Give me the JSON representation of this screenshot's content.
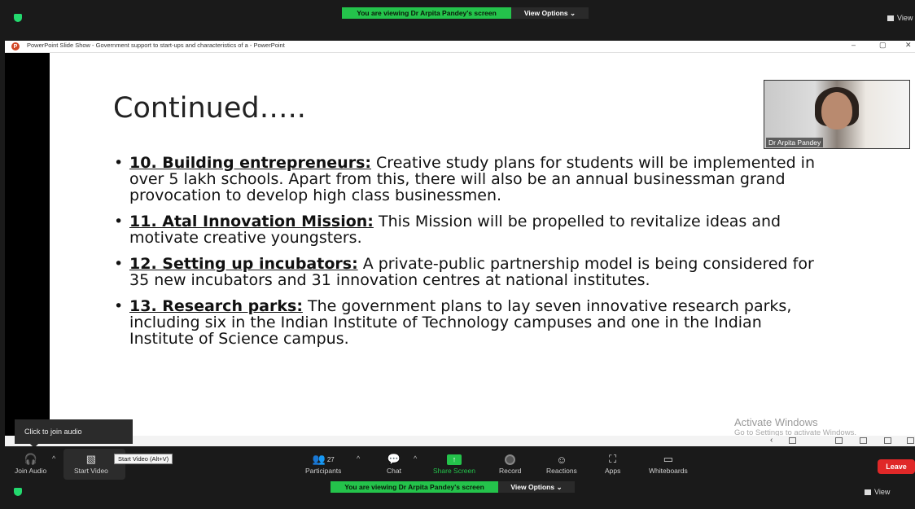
{
  "zoom_top": {
    "viewing_banner": "You are viewing Dr Arpita Pandey's screen",
    "view_options": "View Options ⌄",
    "view_right": "View"
  },
  "powerpoint": {
    "title": "PowerPoint Slide Show  -  Government support to start-ups and characteristics of a  -  PowerPoint",
    "controls": {
      "minimize": "–",
      "restore": "▢",
      "close": "✕"
    }
  },
  "slide": {
    "heading": "Continued…..",
    "bullets": [
      {
        "head": "10. Building entrepreneurs:",
        "text": " Creative study plans for students will be implemented in over 5 lakh schools. Apart from this, there will also be an annual businessman grand provocation to develop high class businessmen."
      },
      {
        "head": "11. Atal Innovation Mission:",
        "text": " This Mission will be propelled to revitalize ideas and motivate creative youngsters."
      },
      {
        "head": "12. Setting up incubators:",
        "text": " A private-public partnership model is being considered for 35 new incubators and 31 innovation centres at national institutes."
      },
      {
        "head": "13. Research parks:",
        "text": " The government plans to lay seven innovative research parks, including six in the Indian Institute of Technology campuses and one in the Indian Institute of Science campus."
      }
    ]
  },
  "speaker": {
    "name": "Dr Arpita Pandey"
  },
  "watermark": {
    "line1": "Activate Windows",
    "line2": "Go to Settings to activate Windows."
  },
  "tooltip": {
    "join_audio": "Click to join audio",
    "start_video": "Start Video (Alt+V)"
  },
  "toolbar": {
    "join_audio": "Join Audio",
    "start_video": "Start Video",
    "participants": "Participants",
    "participants_count": "27",
    "chat": "Chat",
    "share_screen": "Share Screen",
    "record": "Record",
    "reactions": "Reactions",
    "apps": "Apps",
    "whiteboards": "Whiteboards",
    "leave": "Leave",
    "viewing_banner": "You are viewing Dr Arpita Pandey's screen",
    "view_options": "View Options ⌄",
    "view": "View"
  },
  "colors": {
    "zoom_green": "#24c34b",
    "leave_red": "#e02828",
    "ppt_orange": "#d24726"
  }
}
